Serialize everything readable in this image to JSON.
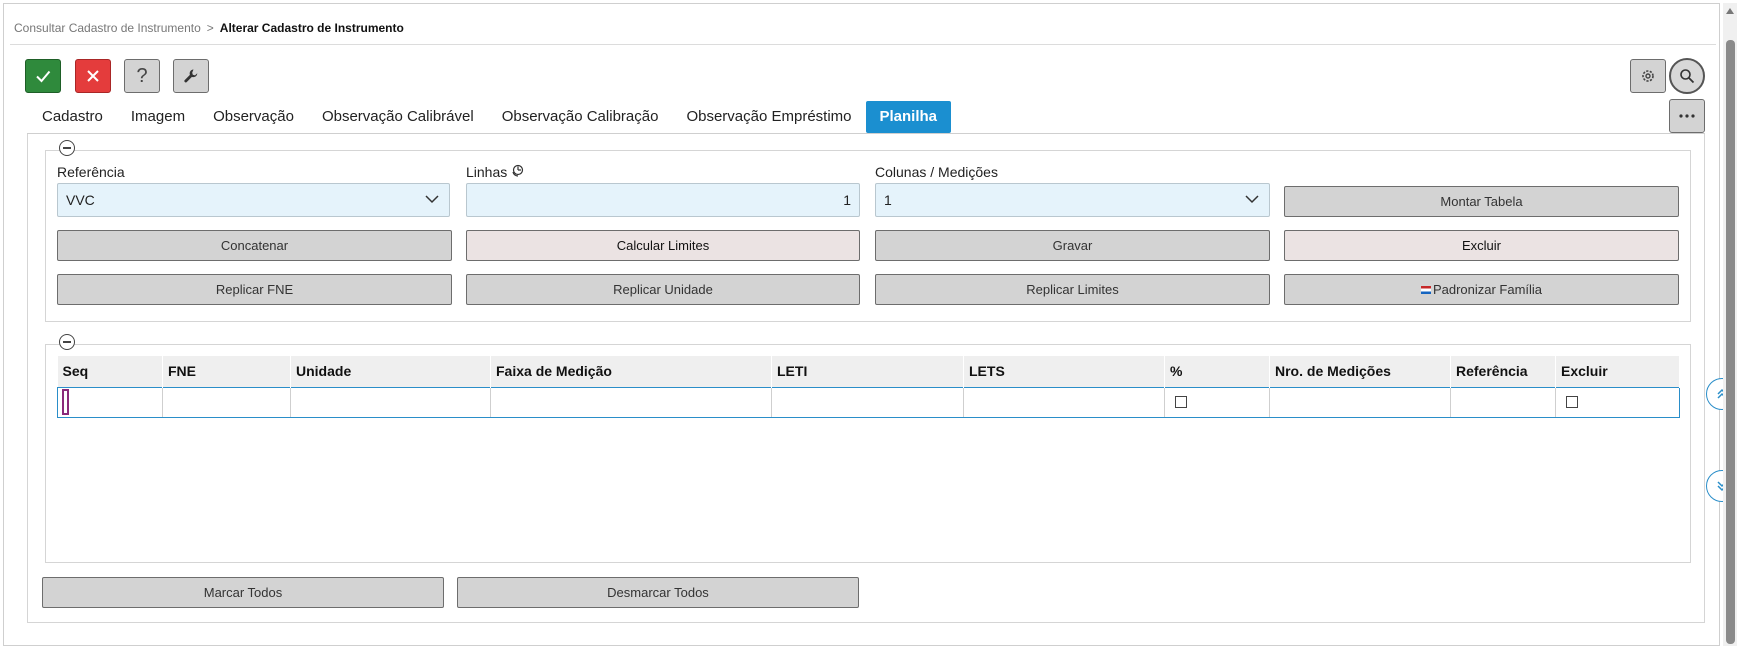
{
  "breadcrumb": {
    "parent": "Consultar Cadastro de Instrumento",
    "separator": ">",
    "current": "Alterar Cadastro de Instrumento"
  },
  "toolbar": {
    "confirm_icon": "check-icon",
    "cancel_icon": "close-icon",
    "help_label": "?",
    "tools_icon": "wrench-icon",
    "settings_icon": "gear-icon",
    "search_icon": "search-icon"
  },
  "tabs": [
    {
      "label": "Cadastro"
    },
    {
      "label": "Imagem"
    },
    {
      "label": "Observação"
    },
    {
      "label": "Observação Calibrável"
    },
    {
      "label": "Observação Calibração"
    },
    {
      "label": "Observação Empréstimo"
    },
    {
      "label": "Planilha",
      "active": true
    }
  ],
  "more_label": "···",
  "form": {
    "referencia_label": "Referência",
    "referencia_value": "VVC",
    "linhas_label": "Linhas",
    "linhas_value": "1",
    "colunas_label": "Colunas / Medições",
    "colunas_value": "1"
  },
  "buttons": {
    "montar_tabela": "Montar Tabela",
    "concatenar": "Concatenar",
    "calcular_limites": "Calcular Limites",
    "gravar": "Gravar",
    "excluir": "Excluir",
    "replicar_fne": "Replicar FNE",
    "replicar_unidade": "Replicar Unidade",
    "replicar_limites": "Replicar Limites",
    "padronizar_familia": "Padronizar Família",
    "marcar_todos": "Marcar Todos",
    "desmarcar_todos": "Desmarcar Todos"
  },
  "grid": {
    "columns": [
      "Seq",
      "FNE",
      "Unidade",
      "Faixa de Medição",
      "LETI",
      "LETS",
      "%",
      "Nro. de Medições",
      "Referência",
      "Excluir"
    ],
    "rows": [
      [
        "",
        "",
        "",
        "",
        "",
        "",
        "",
        "",
        "",
        ""
      ]
    ]
  },
  "colors": {
    "accent": "#1b8fd0",
    "confirm": "#2f8a3c",
    "cancel": "#e43c3c",
    "field_bg": "#e5f3fb"
  }
}
